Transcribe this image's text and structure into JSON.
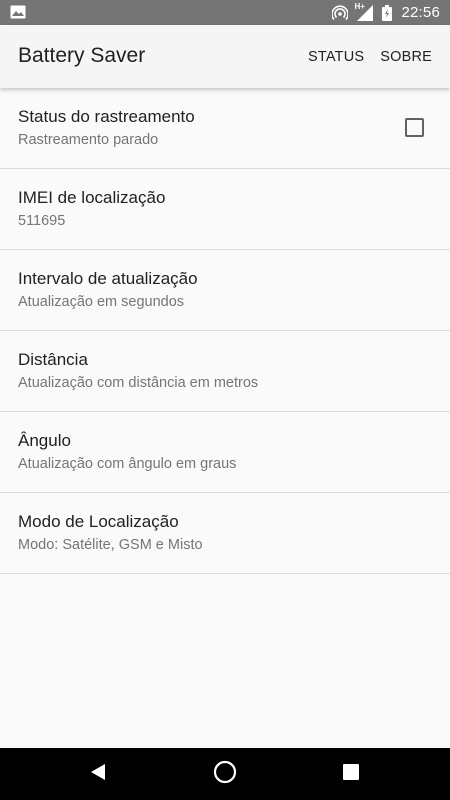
{
  "status_bar": {
    "time": "22:56",
    "network_type": "H+",
    "left_icon": "image-notification-icon",
    "icons": [
      "hotspot-icon",
      "signal-icon",
      "battery-icon"
    ]
  },
  "app_bar": {
    "title": "Battery Saver",
    "actions": [
      {
        "label": "STATUS"
      },
      {
        "label": "SOBRE"
      }
    ]
  },
  "preferences": [
    {
      "title": "Status do rastreamento",
      "summary": "Rastreamento parado",
      "checkbox": true,
      "checked": false
    },
    {
      "title": "IMEI de localização",
      "summary": "511695"
    },
    {
      "title": "Intervalo de atualização",
      "summary": "Atualização em segundos"
    },
    {
      "title": "Distância",
      "summary": "Atualização com distância em metros"
    },
    {
      "title": "Ângulo",
      "summary": "Atualização com ângulo em graus"
    },
    {
      "title": "Modo de Localização",
      "summary": "Modo: Satélite, GSM e Misto"
    }
  ],
  "nav_bar": {
    "buttons": [
      "back-icon",
      "home-icon",
      "recents-icon"
    ]
  },
  "colors": {
    "status_bar": "#757575",
    "app_bar": "#f5f5f5",
    "background": "#fafafa",
    "nav_bar": "#000000",
    "primary_text": "#212121",
    "secondary_text": "#757575",
    "divider": "#dcdcdc"
  }
}
